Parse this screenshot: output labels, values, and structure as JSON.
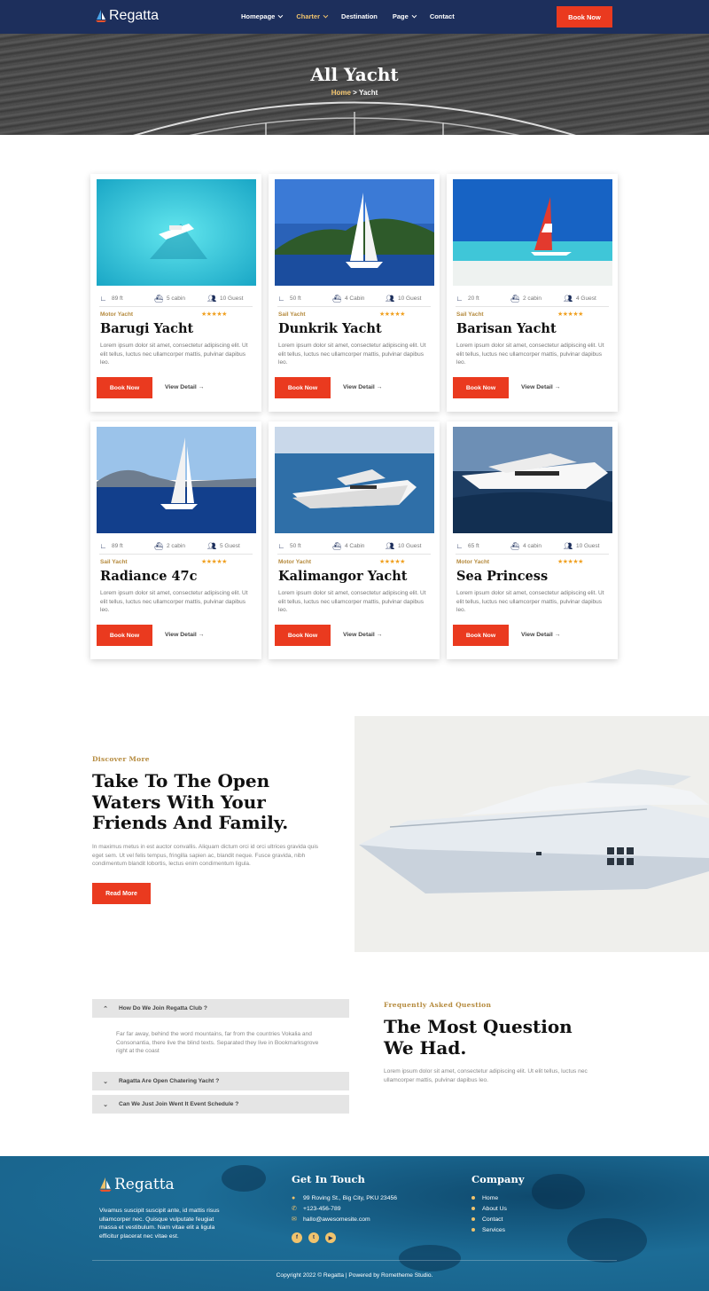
{
  "nav": {
    "brand": "Regatta",
    "menu": [
      {
        "label": "Homepage",
        "has_caret": true
      },
      {
        "label": "Charter",
        "has_caret": true
      },
      {
        "label": "Destination",
        "has_caret": false
      },
      {
        "label": "Page",
        "has_caret": true
      },
      {
        "label": "Contact",
        "has_caret": false
      }
    ],
    "book_label": "Book Now",
    "active_color": "#f0c36d"
  },
  "hero": {
    "title": "All Yacht",
    "crumb_home": "Home",
    "crumb_sep": " > ",
    "crumb_current": "Yacht"
  },
  "yachts": [
    {
      "length": "89 ft",
      "cabins": "5 cabin",
      "guests": "10 Guest",
      "type": "Motor Yacht",
      "name": "Barugi Yacht",
      "desc": "Lorem ipsum dolor sit amet, consectetur adipiscing elit. Ut elit tellus, luctus nec ullamcorper mattis, pulvinar dapibus leo.",
      "book": "Book Now",
      "detail": "View Detail"
    },
    {
      "length": "50 ft",
      "cabins": "4 Cabin",
      "guests": "10 Guest",
      "type": "Sail Yacht",
      "name": "Dunkrik Yacht",
      "desc": "Lorem ipsum dolor sit amet, consectetur adipiscing elit. Ut elit tellus, luctus nec ullamcorper mattis, pulvinar dapibus leo.",
      "book": "Book Now",
      "detail": "View Detail"
    },
    {
      "length": "20 ft",
      "cabins": "2 cabin",
      "guests": "4 Guest",
      "type": "Sail Yacht",
      "name": "Barisan Yacht",
      "desc": "Lorem ipsum dolor sit amet, consectetur adipiscing elit. Ut elit tellus, luctus nec ullamcorper mattis, pulvinar dapibus leo.",
      "book": "Book Now",
      "detail": "View Detail"
    },
    {
      "length": "89 ft",
      "cabins": "2 cabin",
      "guests": "5 Guest",
      "type": "Sail Yacht",
      "name": "Radiance 47c",
      "desc": "Lorem ipsum dolor sit amet, consectetur adipiscing elit. Ut elit tellus, luctus nec ullamcorper mattis, pulvinar dapibus leo.",
      "book": "Book Now",
      "detail": "View Detail"
    },
    {
      "length": "50 ft",
      "cabins": "4 Cabin",
      "guests": "10 Guest",
      "type": "Motor Yacht",
      "name": "Kalimangor Yacht",
      "desc": "Lorem ipsum dolor sit amet, consectetur adipiscing elit. Ut elit tellus, luctus nec ullamcorper mattis, pulvinar dapibus leo.",
      "book": "Book Now",
      "detail": "View Detail"
    },
    {
      "length": "65 ft",
      "cabins": "4 cabin",
      "guests": "10 Guest",
      "type": "Motor Yacht",
      "name": "Sea Princess",
      "desc": "Lorem ipsum dolor sit amet, consectetur adipiscing elit. Ut elit tellus, luctus nec ullamcorper mattis, pulvinar dapibus leo.",
      "book": "Book Now",
      "detail": "View Detail"
    }
  ],
  "discover": {
    "tag": "Discover More",
    "title": "Take To The Open Waters With Your Friends And Family.",
    "text": "In maximus metus in est auctor convallis. Aliquam dictum orci id orci ultrices gravida quis eget sem. Ut vel felis tempus, fringilla sapien ac, blandit neque. Fusce gravida, nibh condimentum blandit lobortis, lectus enim condimentum ligula.",
    "button": "Read More"
  },
  "faq": {
    "questions": [
      {
        "q": "How Do We Join Regatta Club ?",
        "open": true
      },
      {
        "q": "Ragatta Are Open Chatering Yacht ?",
        "open": false
      },
      {
        "q": "Can We Just Join Went It Event Schedule ?",
        "open": false
      }
    ],
    "answer": "Far far away, behind the word mountains, far from the countries Vokalia and Consonantia, there live the blind texts. Separated they live in Bookmarksgrove right at the coast",
    "tag": "Frequently Asked Question",
    "title": "The Most Question We Had.",
    "text": "Lorem ipsum dolor sit amet, consectetur adipiscing elit. Ut elit tellus, luctus nec ullamcorper mattis, pulvinar dapibus leo."
  },
  "footer": {
    "brand": "Regatta",
    "about": "Vivamus suscipit suscipit ante, id mattis risus ullamcorper nec. Quisque vulputate feugiat massa et vestibulum. Nam vitae elit a ligula efficitur placerat nec vitae est.",
    "contact_heading": "Get In Touch",
    "address": "99 Roving St., Big City, PKU 23456",
    "phone": "+123-456-789",
    "email": "hallo@awesomesite.com",
    "company_heading": "Company",
    "links": [
      "Home",
      "About Us",
      "Contact",
      "Services"
    ],
    "copyright": "Copyright 2022 © Regatta | Powered by Rometheme Studio."
  },
  "colors": {
    "navy": "#1d2f5c",
    "accent": "#ea3a1f",
    "gold": "#b58a3d",
    "star": "#f0a020"
  }
}
